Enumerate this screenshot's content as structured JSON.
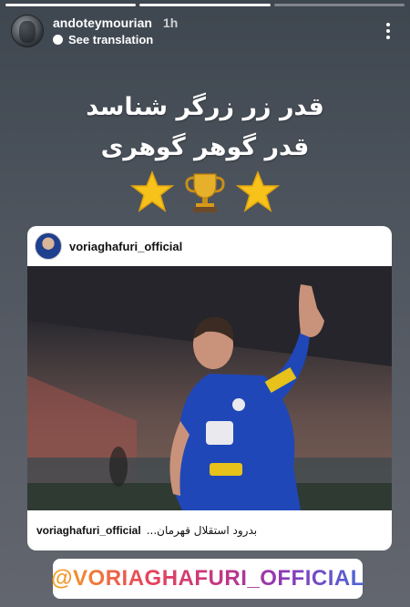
{
  "story": {
    "progress_segments": 3,
    "progress_done": 2
  },
  "header": {
    "username": "andoteymourian",
    "time": "1h",
    "translate_label": "See translation"
  },
  "caption": {
    "line1": "قدر زر زرگر شناسد",
    "line2": "قدر گوهر گوهری"
  },
  "emojis": [
    "star-icon",
    "trophy-icon",
    "star-icon"
  ],
  "post": {
    "username": "voriaghafuri_official",
    "caption_user": "voriaghafuri_official",
    "caption_text": "بدرود استقلال قهرمان..."
  },
  "mention": {
    "text": "@VORIAGHAFURI_OFFICIAL"
  },
  "colors": {
    "background_top": "#3e464f",
    "background_bottom": "#63666f",
    "star": "#f7c21a",
    "trophy": "#d89a1a"
  }
}
